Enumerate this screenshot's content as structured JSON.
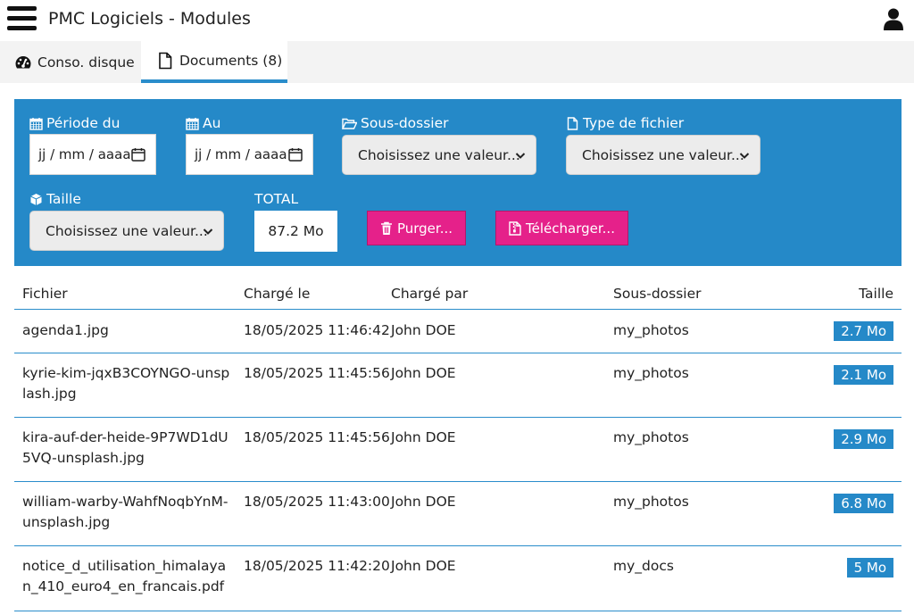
{
  "header": {
    "title": "PMC Logiciels - Modules"
  },
  "tabs": [
    {
      "label": "Conso. disque",
      "icon": "dashboard-icon"
    },
    {
      "label": "Documents (8)",
      "icon": "document-icon",
      "active": true
    }
  ],
  "filters": {
    "periode_du": {
      "label": "Période du",
      "placeholder": "jj / mm / aaaa"
    },
    "au": {
      "label": "Au",
      "placeholder": "jj / mm / aaaa"
    },
    "sous_dossier": {
      "label": "Sous-dossier",
      "value": "Choisissez une valeur..."
    },
    "type_fichier": {
      "label": "Type de fichier",
      "value": "Choisissez une valeur..."
    },
    "taille": {
      "label": "Taille",
      "value": "Choisissez une valeur..."
    },
    "total": {
      "label": "TOTAL",
      "value": "87.2 Mo"
    },
    "purge_label": "Purger...",
    "download_label": "Télécharger..."
  },
  "colors": {
    "accent": "#2589c8",
    "button": "#e5218a"
  },
  "table": {
    "columns": [
      "Fichier",
      "Chargé le",
      "Chargé par",
      "Sous-dossier",
      "Taille"
    ],
    "rows": [
      {
        "file": "agenda1.jpg",
        "date": "18/05/2025 11:46:42",
        "by": "John DOE",
        "sub": "my_photos",
        "size": "2.7 Mo"
      },
      {
        "file": "kyrie-kim-jqxB3COYNGO-unsplash.jpg",
        "date": "18/05/2025 11:45:56",
        "by": "John DOE",
        "sub": "my_photos",
        "size": "2.1 Mo"
      },
      {
        "file": "kira-auf-der-heide-9P7WD1dU5VQ-unsplash.jpg",
        "date": "18/05/2025 11:45:56",
        "by": "John DOE",
        "sub": "my_photos",
        "size": "2.9 Mo"
      },
      {
        "file": "william-warby-WahfNoqbYnM-unsplash.jpg",
        "date": "18/05/2025 11:43:00",
        "by": "John DOE",
        "sub": "my_photos",
        "size": "6.8 Mo"
      },
      {
        "file": "notice_d_utilisation_himalayan_410_euro4_en_francais.pdf",
        "date": "18/05/2025 11:42:20",
        "by": "John DOE",
        "sub": "my_docs",
        "size": "5 Mo"
      }
    ]
  }
}
